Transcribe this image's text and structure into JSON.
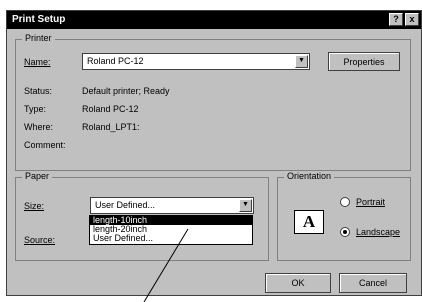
{
  "window": {
    "title": "Print Setup",
    "help_btn": "?",
    "close_btn": "x"
  },
  "printer": {
    "group_label": "Printer",
    "name_label": "Name:",
    "name_value": "Roland PC-12",
    "properties_label": "Properties",
    "status_label": "Status:",
    "status_value": "Default printer; Ready",
    "type_label": "Type:",
    "type_value": "Roland PC-12",
    "where_label": "Where:",
    "where_value": "Roland_LPT1:",
    "comment_label": "Comment:",
    "comment_value": ""
  },
  "paper": {
    "group_label": "Paper",
    "size_label": "Size:",
    "size_value": "User Defined...",
    "source_label": "Source:",
    "size_options": [
      "length-10inch",
      "length-20inch",
      "User Defined..."
    ],
    "selected_index": 0
  },
  "orientation": {
    "group_label": "Orientation",
    "portrait_label": "Portrait",
    "landscape_label": "Landscape",
    "selected": "Landscape",
    "icon_glyph": "A"
  },
  "buttons": {
    "ok": "OK",
    "cancel": "Cancel"
  }
}
